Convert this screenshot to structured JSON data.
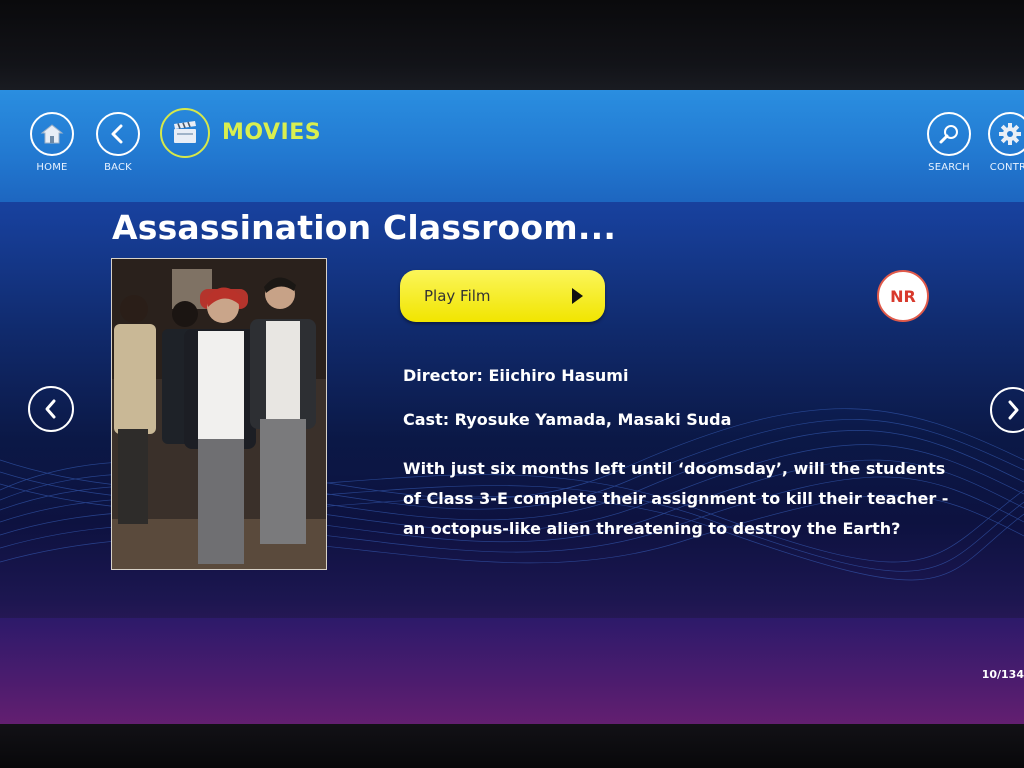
{
  "nav": {
    "home_label": "HOME",
    "back_label": "BACK",
    "section_title": "MOVIES",
    "search_label": "SEARCH",
    "controls_label": "CONTR"
  },
  "movie": {
    "title": "Assassination Classroom...",
    "play_label": "Play Film",
    "rating": "NR",
    "director": "Director: Eiichiro Hasumi",
    "cast": "Cast: Ryosuke Yamada, Masaki Suda",
    "synopsis": "With just six months left until ‘doomsday’, will the students of Class 3-E complete their assignment to kill their teacher - an octopus-like alien threatening to destroy the Earth?"
  },
  "pagination": {
    "counter": "10/134"
  },
  "colors": {
    "accent_yellow": "#f1e500",
    "section_title": "#d9ef4f",
    "rating_red": "#d8392c",
    "topbar_blue": "#2278d0"
  },
  "icons": [
    "home-icon",
    "back-icon",
    "movies-clapper-icon",
    "search-icon",
    "gear-icon",
    "chevron-left-icon",
    "chevron-right-icon",
    "play-arrow-icon"
  ]
}
